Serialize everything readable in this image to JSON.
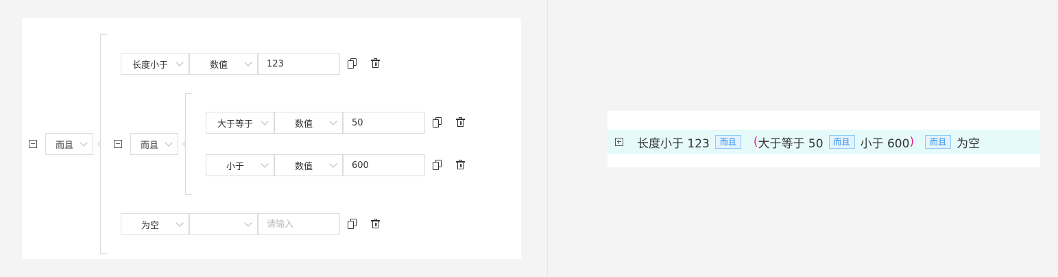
{
  "editor": {
    "root": {
      "logic": "而且"
    },
    "rows": [
      {
        "condition": "长度小于",
        "value_type": "数值",
        "value": "123"
      },
      {
        "condition": "为空",
        "value_type": "",
        "value": "",
        "placeholder": "请输入"
      }
    ],
    "group": {
      "logic": "而且",
      "rows": [
        {
          "condition": "大于等于",
          "value_type": "数值",
          "value": "50"
        },
        {
          "condition": "小于",
          "value_type": "数值",
          "value": "600"
        }
      ]
    }
  },
  "preview": {
    "seg1": "长度小于 123",
    "and1": "而且",
    "open_paren": "(",
    "seg2": "大于等于 50",
    "and2": "而且",
    "seg3": "小于 600",
    "close_paren": ")",
    "and3": "而且",
    "seg4": "为空"
  },
  "icons": {
    "copy": "copy-icon",
    "delete": "trash-icon",
    "collapse": "minus-square-icon",
    "expand": "plus-square-icon"
  },
  "colors": {
    "tag_border": "#90caf9",
    "tag_text": "#1e88e5",
    "paren": "#e91e8c",
    "row_highlight": "#e6fafa"
  }
}
